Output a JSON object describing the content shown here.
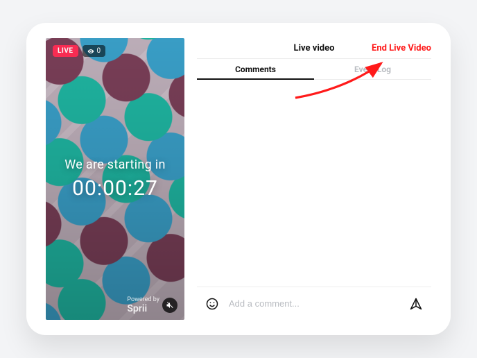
{
  "header": {
    "title": "Live video",
    "end_button": "End Live Video"
  },
  "tabs": [
    {
      "label": "Comments",
      "active": true
    },
    {
      "label": "Event Log",
      "active": false
    }
  ],
  "video": {
    "live_badge": "LIVE",
    "viewer_count": "0",
    "overlay_line1": "We are starting in",
    "countdown": "00:00:27",
    "powered_by_label": "Powered by",
    "powered_by_brand": "Sprii"
  },
  "composer": {
    "placeholder": "Add a comment..."
  },
  "icons": {
    "eye": "eye-icon",
    "mute": "mute-icon",
    "emoji": "emoji-icon",
    "send": "send-icon"
  },
  "colors": {
    "accent_red": "#ff1a1a",
    "live_red": "#ff2d55"
  }
}
